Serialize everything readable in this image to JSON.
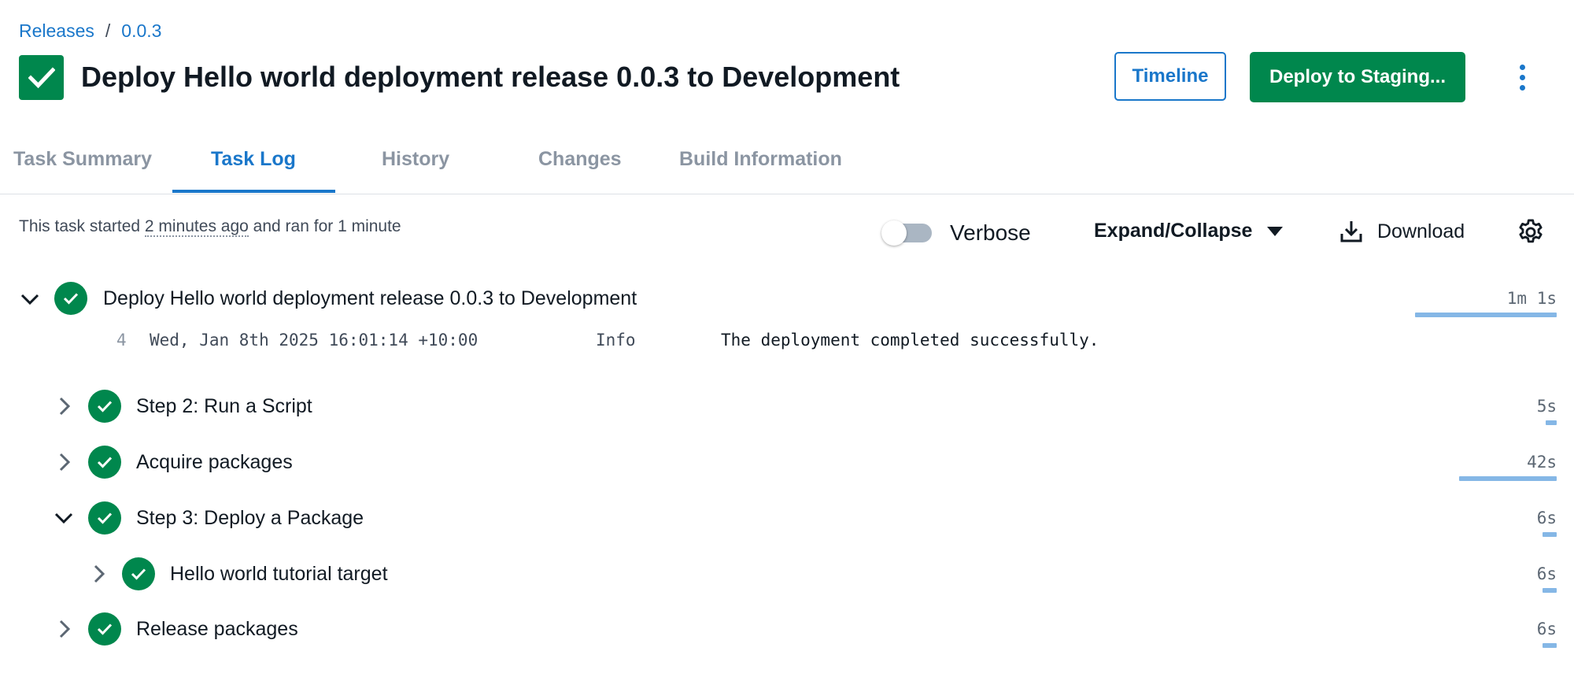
{
  "breadcrumb": {
    "releases": "Releases",
    "separator": "/",
    "version": "0.0.3"
  },
  "header": {
    "title": "Deploy Hello world deployment release 0.0.3 to Development",
    "timeline_button": "Timeline",
    "deploy_button": "Deploy to Staging..."
  },
  "tabs": [
    {
      "label": "Task Summary",
      "active": false
    },
    {
      "label": "Task Log",
      "active": true
    },
    {
      "label": "History",
      "active": false
    },
    {
      "label": "Changes",
      "active": false
    },
    {
      "label": "Build Information",
      "active": false
    }
  ],
  "info": {
    "started_prefix": "This task started",
    "started_relative": "2 minutes ago",
    "started_suffix": "and ran for 1 minute"
  },
  "toolbar": {
    "verbose_label": "Verbose",
    "verbose_on": false,
    "expand_label": "Expand/Collapse",
    "download_label": "Download"
  },
  "log": {
    "root": {
      "label": "Deploy Hello world deployment release 0.0.3 to Development",
      "duration": "1m 1s",
      "expanded": true,
      "bar_fraction": 1.0
    },
    "line": {
      "number": "4",
      "timestamp": "Wed, Jan 8th 2025 16:01:14 +10:00",
      "level": "Info",
      "message": "The deployment completed successfully."
    },
    "steps": [
      {
        "label": "Step 2: Run a Script",
        "duration": "5s",
        "expanded": false,
        "bar_fraction": 0.08
      },
      {
        "label": "Acquire packages",
        "duration": "42s",
        "expanded": false,
        "bar_fraction": 0.69
      },
      {
        "label": "Step 3: Deploy a Package",
        "duration": "6s",
        "expanded": true,
        "bar_fraction": 0.1
      },
      {
        "label": "Hello world tutorial target",
        "duration": "6s",
        "expanded": false,
        "bar_fraction": 0.1
      },
      {
        "label": "Release packages",
        "duration": "6s",
        "expanded": false,
        "bar_fraction": 0.1
      }
    ]
  },
  "colors": {
    "accent": "#1a77ca",
    "success": "#00874d",
    "bar": "#85b7e6"
  },
  "icons": {
    "status": "check-icon",
    "more": "kebab-icon",
    "download": "download-icon",
    "settings": "gear-icon"
  }
}
